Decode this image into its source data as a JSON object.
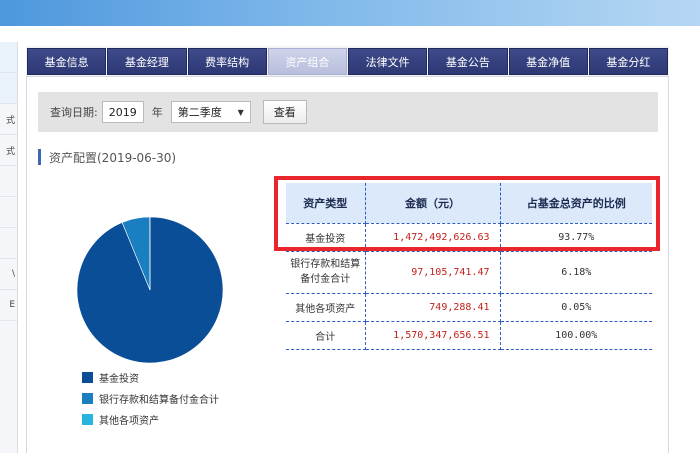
{
  "left_strip": [
    "",
    "",
    "式",
    "式",
    "",
    "",
    "",
    "\\",
    "E"
  ],
  "tabs": [
    {
      "label": "基金信息",
      "active": false
    },
    {
      "label": "基金经理",
      "active": false
    },
    {
      "label": "费率结构",
      "active": false
    },
    {
      "label": "资产组合",
      "active": true
    },
    {
      "label": "法律文件",
      "active": false
    },
    {
      "label": "基金公告",
      "active": false
    },
    {
      "label": "基金净值",
      "active": false
    },
    {
      "label": "基金分红",
      "active": false
    }
  ],
  "query": {
    "date_label": "查询日期:",
    "year_value": "2019",
    "year_unit": "年",
    "season_value": "第二季度",
    "view_button": "查看"
  },
  "section": {
    "title": "资产配置(2019-06-30)"
  },
  "table": {
    "headers": [
      "资产类型",
      "金额（元）",
      "占基金总资产的比例"
    ],
    "rows": [
      {
        "type": "基金投资",
        "amount": "1,472,492,626.63",
        "pct": "93.77%"
      },
      {
        "type": "银行存款和结算备付金合计",
        "amount": "97,105,741.47",
        "pct": "6.18%"
      },
      {
        "type": "其他各项资产",
        "amount": "749,288.41",
        "pct": "0.05%"
      },
      {
        "type": "合计",
        "amount": "1,570,347,656.51",
        "pct": "100.00%"
      }
    ]
  },
  "chart_data": {
    "type": "pie",
    "title": "",
    "slices": [
      {
        "name": "基金投资",
        "value": 93.77,
        "color": "#0b4e98"
      },
      {
        "name": "银行存款和结算备付金合计",
        "value": 6.18,
        "color": "#1a7fc0"
      },
      {
        "name": "其他各项资产",
        "value": 0.05,
        "color": "#29b4e0"
      }
    ],
    "legend_placement": "bottom"
  },
  "colors": {
    "highlight": "#e8262b",
    "tab_bg": "#2d3874",
    "amount_text": "#c4211b"
  }
}
